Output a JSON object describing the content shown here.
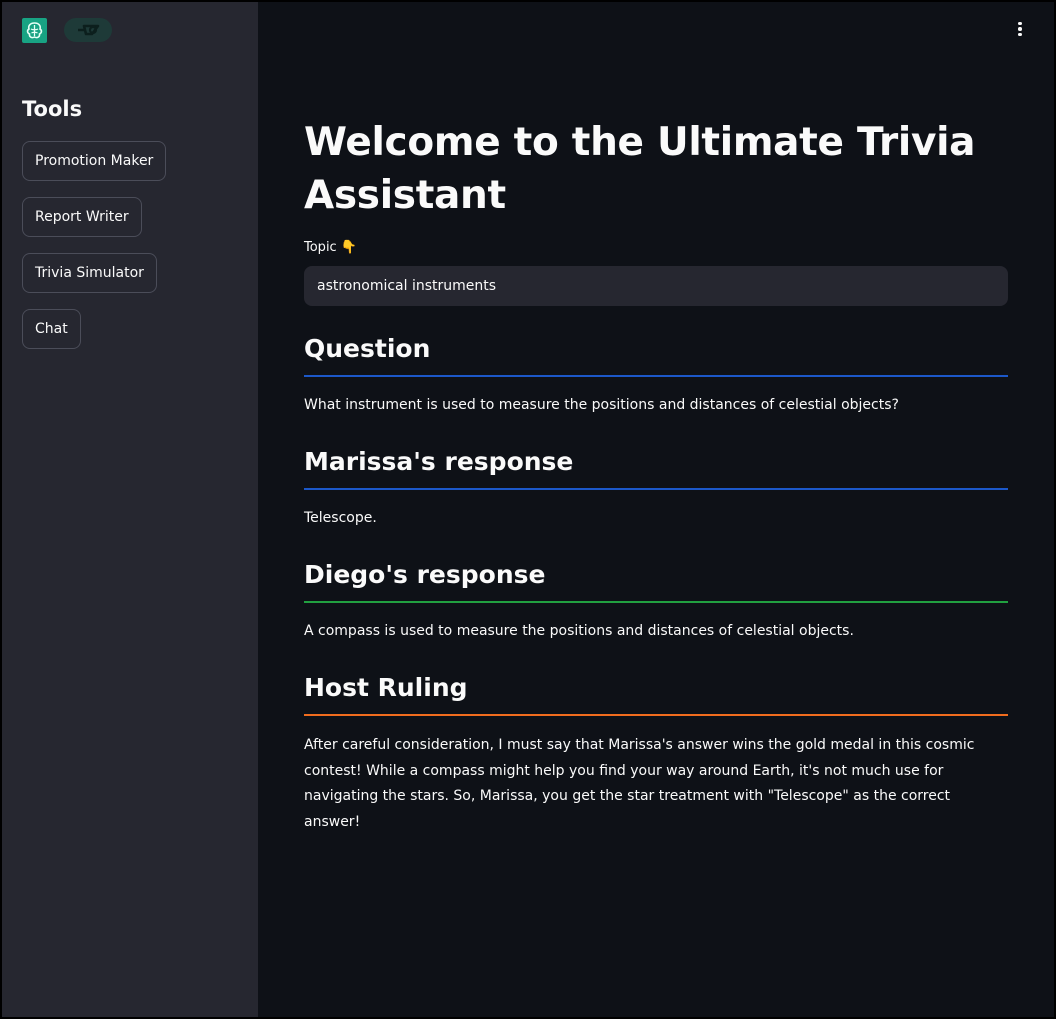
{
  "sidebar": {
    "title": "Tools",
    "buttons": [
      "Promotion Maker",
      "Report Writer",
      "Trivia Simulator",
      "Chat"
    ]
  },
  "header": {
    "logo_icon": "app-logo-icon",
    "badge_icon": "link-badge-icon",
    "menu_icon": "kebab-menu-icon"
  },
  "main": {
    "title": "Welcome to the Ultimate Trivia Assistant",
    "topic_label": "Topic 👇",
    "topic_value": "astronomical instruments",
    "sections": [
      {
        "heading": "Question",
        "rule_color": "#1c58c9",
        "text": "What instrument is used to measure the positions and distances of celestial objects?"
      },
      {
        "heading": "Marissa's response",
        "rule_color": "#1c58c9",
        "text": "Telescope."
      },
      {
        "heading": "Diego's response",
        "rule_color": "#21a040",
        "text": "A compass is used to measure the positions and distances of celestial objects."
      },
      {
        "heading": "Host Ruling",
        "rule_color": "#f06c1e",
        "text": "After careful consideration, I must say that Marissa's answer wins the gold medal in this cosmic contest! While a compass might help you find your way around Earth, it's not much use for navigating the stars. So, Marissa, you get the star treatment with \"Telescope\" as the correct answer!"
      }
    ]
  },
  "colors": {
    "background": "#0e1117",
    "sidebar": "#262730",
    "text": "#fafafa"
  }
}
